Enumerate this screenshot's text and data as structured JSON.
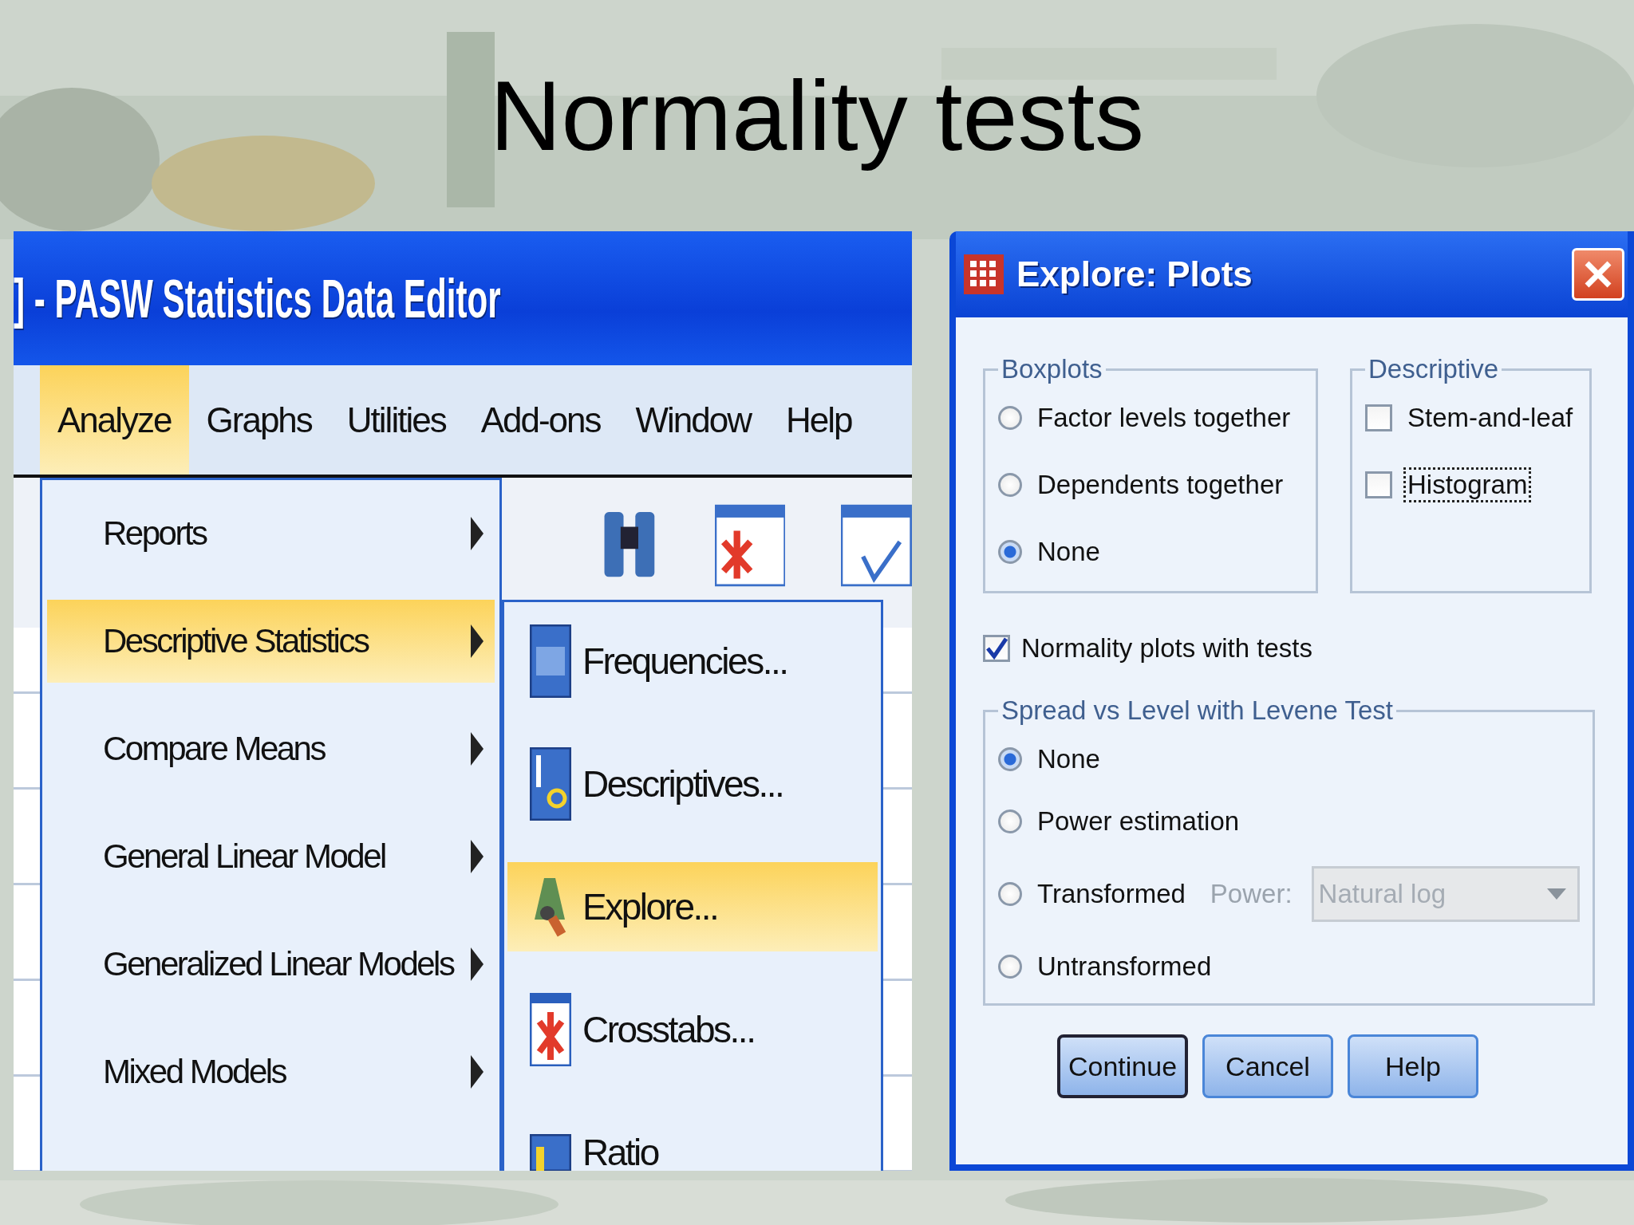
{
  "slide": {
    "title": "Normality tests"
  },
  "editor": {
    "title": "] - PASW Statistics Data Editor",
    "menu_bar": [
      {
        "label": "Analyze",
        "selected": true
      },
      {
        "label": "Graphs",
        "selected": false
      },
      {
        "label": "Utilities",
        "selected": false
      },
      {
        "label": "Add-ons",
        "selected": false
      },
      {
        "label": "Window",
        "selected": false
      },
      {
        "label": "Help",
        "selected": false
      }
    ],
    "menu": [
      {
        "label": "Reports",
        "selected": false
      },
      {
        "label": "Descriptive Statistics",
        "selected": true
      },
      {
        "label": "Compare Means",
        "selected": false
      },
      {
        "label": "General Linear Model",
        "selected": false
      },
      {
        "label": "Generalized Linear Models",
        "selected": false
      },
      {
        "label": "Mixed Models",
        "selected": false
      }
    ],
    "submenu": [
      {
        "label": "Frequencies...",
        "selected": false,
        "kind": "numbers"
      },
      {
        "label": "Descriptives...",
        "selected": false,
        "kind": "mu"
      },
      {
        "label": "Explore...",
        "selected": true,
        "kind": "explore"
      },
      {
        "label": "Crosstabs...",
        "selected": false,
        "kind": "crosstab"
      },
      {
        "label": "Ratio",
        "selected": false,
        "kind": "ratio"
      }
    ]
  },
  "dialog": {
    "title": "Explore: Plots",
    "boxplots": {
      "legend": "Boxplots",
      "options": [
        {
          "label": "Factor levels together",
          "selected": false
        },
        {
          "label": "Dependents together",
          "selected": false
        },
        {
          "label": "None",
          "selected": true
        }
      ]
    },
    "descriptive": {
      "legend": "Descriptive",
      "options": [
        {
          "label": "Stem-and-leaf",
          "checked": false,
          "focused": false
        },
        {
          "label": "Histogram",
          "checked": false,
          "focused": true
        }
      ]
    },
    "normality": {
      "label": "Normality plots with tests",
      "checked": true
    },
    "spread": {
      "legend": "Spread vs Level with Levene Test",
      "options": [
        {
          "label": "None",
          "selected": true
        },
        {
          "label": "Power estimation",
          "selected": false
        },
        {
          "label": "Transformed",
          "selected": false
        },
        {
          "label": "Untransformed",
          "selected": false
        }
      ],
      "power": {
        "label": "Power:",
        "value": "Natural log",
        "disabled": true
      }
    },
    "buttons": [
      {
        "label": "Continue",
        "default": true
      },
      {
        "label": "Cancel",
        "default": false
      },
      {
        "label": "Help",
        "default": false
      }
    ]
  }
}
